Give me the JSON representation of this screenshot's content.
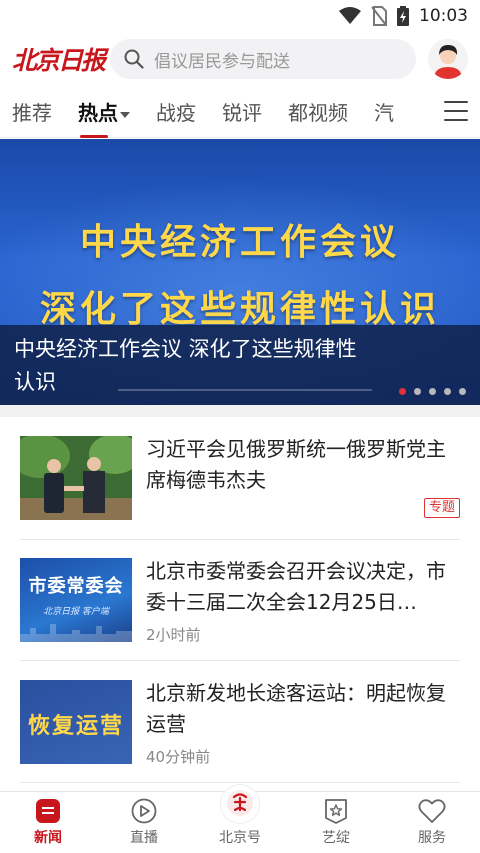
{
  "status_bar": {
    "time": "10:03",
    "icons": [
      "wifi-icon",
      "no-sim-icon",
      "battery-charging-icon"
    ]
  },
  "header": {
    "logo": "北京日报",
    "search_placeholder": "倡议居民参与配送",
    "avatar": "user-avatar"
  },
  "tabs": [
    {
      "label": "推荐",
      "active": false
    },
    {
      "label": "热点",
      "active": true
    },
    {
      "label": "战疫",
      "active": false
    },
    {
      "label": "锐评",
      "active": false
    },
    {
      "label": "都视频",
      "active": false
    },
    {
      "label": "汽",
      "active": false
    }
  ],
  "banner": {
    "image_line1": "中央经济工作会议",
    "image_line2": "深化了这些规律性认识",
    "caption": "中央经济工作会议 深化了这些规律性认识",
    "slides": 5,
    "active_slide": 1
  },
  "news": [
    {
      "title": "习近平会见俄罗斯统一俄罗斯党主席梅德韦杰夫",
      "tag": "专题",
      "time": ""
    },
    {
      "title": "北京市委常委会召开会议决定，市委十三届二次全会12月25日…",
      "time": "2小时前",
      "thumb_text": "市委常委会",
      "thumb_sub": "北京日报 客户端"
    },
    {
      "title": "北京新发地长途客运站：明起恢复运营",
      "time": "40分钟前",
      "thumb_text": "恢复运营"
    }
  ],
  "bottom_nav": [
    {
      "label": "新闻",
      "icon": "news-icon",
      "active": true
    },
    {
      "label": "直播",
      "icon": "play-icon",
      "active": false
    },
    {
      "label": "北京号",
      "icon": "beijing-logo-icon",
      "active": false
    },
    {
      "label": "艺绽",
      "icon": "star-badge-icon",
      "active": false
    },
    {
      "label": "服务",
      "icon": "heart-icon",
      "active": false
    }
  ],
  "colors": {
    "brand_red": "#c8161d",
    "banner_blue": "#245ac4",
    "banner_text": "#ffd84a"
  }
}
